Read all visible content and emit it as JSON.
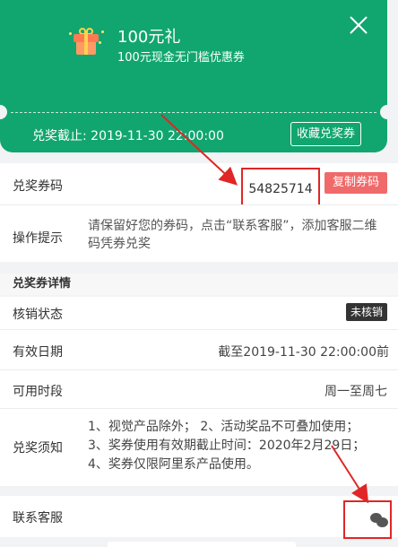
{
  "coupon": {
    "title": "100元礼",
    "subtitle": "100元现金无门槛优惠券",
    "deadline": "兑奖截止: 2019-11-30 22:00:00",
    "favorite_label": "收藏兑奖券",
    "color": "#11a66f"
  },
  "code_row": {
    "label": "兑奖券码",
    "code": "54825714",
    "copy_label": "复制券码"
  },
  "tip_row": {
    "label": "操作提示",
    "text": "请保留好您的券码，点击“联系客服”，添加客服二维码凭券兑奖"
  },
  "section": {
    "title": "兑奖券详情"
  },
  "status_row": {
    "label": "核销状态",
    "value": "未核销"
  },
  "valid_row": {
    "label": "有效日期",
    "value": "截至2019-11-30 22:00:00前"
  },
  "time_row": {
    "label": "可用时段",
    "value": "周一至周七"
  },
  "notice_row": {
    "label": "兑奖须知",
    "lines": [
      "1、视觉产品除外； 2、活动奖品不可叠加使用；",
      "3、奖券使用有效期截止时间：2020年2月29日；",
      "4、奖券仅限阿里系产品使用。"
    ]
  },
  "service_row": {
    "label": "联系客服",
    "icon": "wechat-icon"
  },
  "annotation_color": "#e02626"
}
